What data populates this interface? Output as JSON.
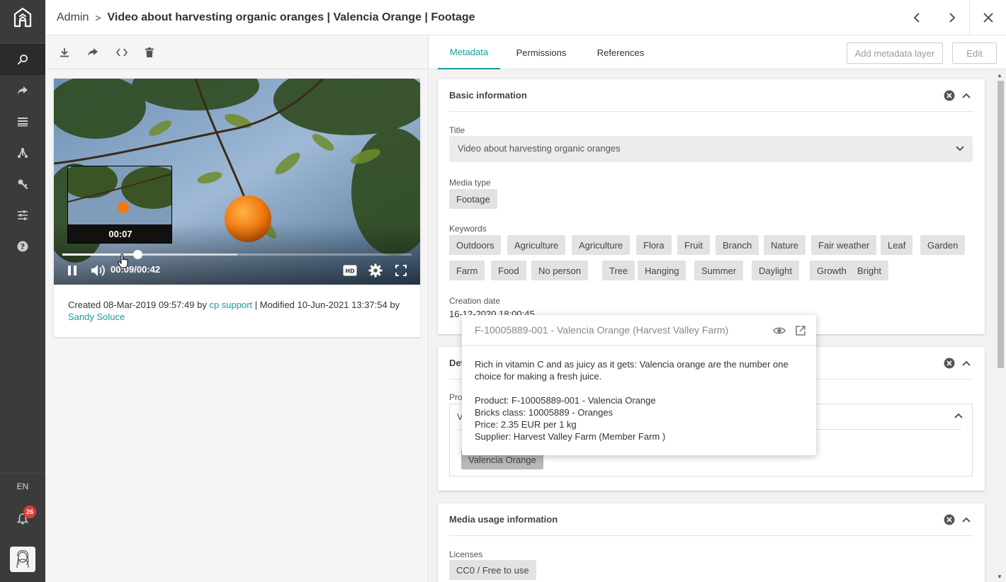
{
  "header": {
    "breadcrumb_root": "Admin",
    "breadcrumb_sep": ">",
    "title": "Video about harvesting organic oranges | Valencia Orange | Footage"
  },
  "sidebar": {
    "lang": "EN",
    "notification_count": "26",
    "items": [
      {
        "icon": "search-icon"
      },
      {
        "icon": "share-icon"
      },
      {
        "icon": "list-icon"
      },
      {
        "icon": "hierarchy-icon"
      },
      {
        "icon": "key-icon"
      },
      {
        "icon": "sliders-icon"
      },
      {
        "icon": "help-icon"
      }
    ]
  },
  "player": {
    "preview_time": "00:07",
    "current_time": "00:09",
    "duration": "00:42",
    "time_display": "00:09/00:42",
    "progress": 0.214,
    "buffered": 0.5,
    "hd_label": "HD"
  },
  "media_info": {
    "created_prefix": "Created 08-Mar-2019 09:57:49 by ",
    "created_by": "cp support",
    "modified_text": " | Modified 10-Jun-2021 13:37:54 by ",
    "modified_by": "Sandy Soluce"
  },
  "tabs": [
    {
      "label": "Metadata",
      "active": true
    },
    {
      "label": "Permissions",
      "active": false
    },
    {
      "label": "References",
      "active": false
    }
  ],
  "actions": {
    "add_layer": "Add metadata layer",
    "edit": "Edit"
  },
  "basic_info": {
    "title": "Basic information",
    "title_label": "Title",
    "title_value": "Video about harvesting organic oranges",
    "media_type_label": "Media type",
    "media_type": "Footage",
    "keywords_label": "Keywords",
    "keywords": [
      "Outdoors",
      "Agriculture",
      "Agriculture",
      "Flora",
      "Fruit",
      "Branch",
      "Nature",
      "Fair weather",
      "Leaf",
      "Garden",
      "Farm",
      "Food",
      "No person",
      "Tree",
      "Hanging",
      "Summer",
      "Daylight",
      "Growth",
      "Bright"
    ],
    "creation_date_label": "Creation date",
    "creation_date": "16-12-2020 18:00:45"
  },
  "detail_section": {
    "title_partial": "Det",
    "field_label_partial": "Pro",
    "select_partial": "V",
    "chip": "Valencia Orange"
  },
  "usage_info": {
    "title": "Media usage information",
    "licenses_label": "Licenses",
    "license": "CC0 / Free to use"
  },
  "popover": {
    "title": "F-10005889-001 - Valencia Orange (Harvest Valley Farm)",
    "description": "Rich in vitamin C and as juicy as it gets: Valencia orange are the number one choice for making a fresh juice.",
    "product": "Product: F-10005889-001 - Valencia Orange",
    "bricks": "Bricks class: 10005889 - Oranges",
    "price": "Price: 2.35 EUR per 1 kg",
    "supplier": "Supplier: Harvest Valley Farm (Member Farm )"
  },
  "colors": {
    "accent": "#1a9b9b",
    "sidebar": "#3b3b3b",
    "badge": "#e53935"
  }
}
